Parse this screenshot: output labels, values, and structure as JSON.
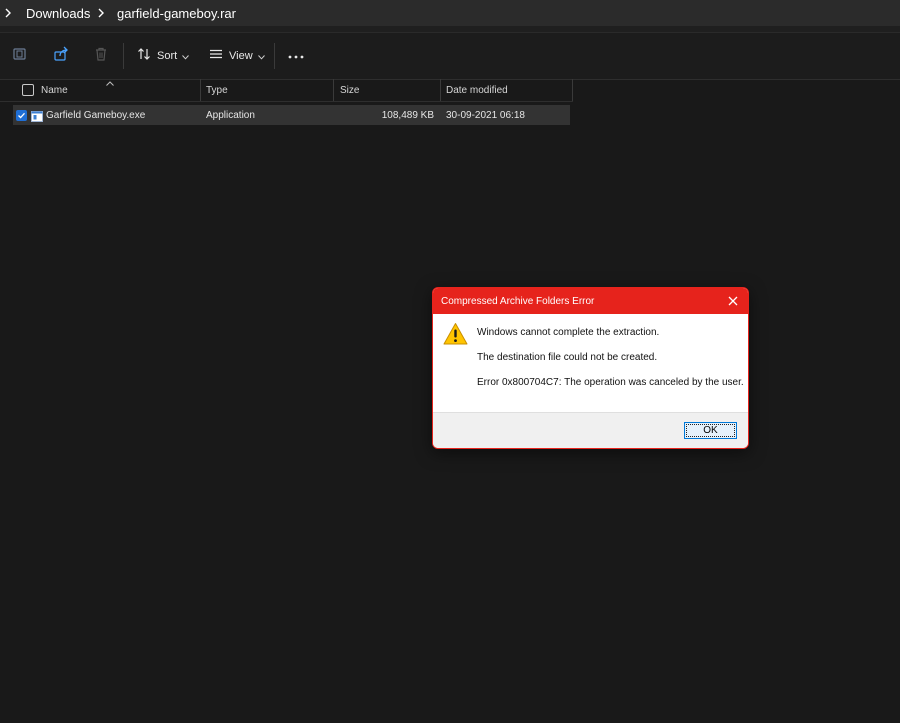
{
  "breadcrumb": {
    "items": [
      "Downloads",
      "garfield-gameboy.rar"
    ]
  },
  "toolbar": {
    "sort_label": "Sort",
    "view_label": "View"
  },
  "columns": [
    "Name",
    "Type",
    "Size",
    "Date modified"
  ],
  "files": [
    {
      "name": "Garfield Gameboy.exe",
      "type": "Application",
      "size": "108,489 KB",
      "date_modified": "30-09-2021 06:18",
      "selected": true
    }
  ],
  "dialog": {
    "title": "Compressed Archive Folders Error",
    "messages": [
      "Windows cannot complete the extraction.",
      "The destination file could not be created.",
      "Error 0x800704C7: The operation was canceled by the user."
    ],
    "ok_label": "OK"
  },
  "colors": {
    "dialog_accent": "#e6231c",
    "selection": "#1f6fd6",
    "background": "#191919"
  }
}
